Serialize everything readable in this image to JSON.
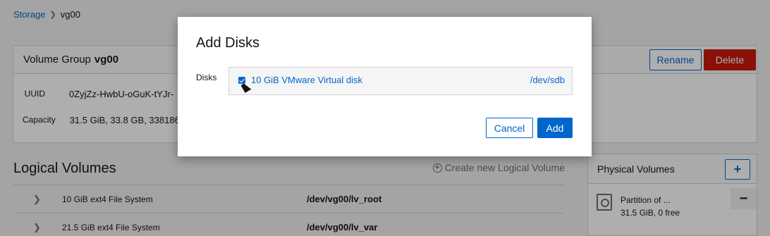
{
  "breadcrumb": {
    "root": "Storage",
    "current": "vg00"
  },
  "volume_group": {
    "label": "Volume Group",
    "name": "vg00",
    "rename_label": "Rename",
    "delete_label": "Delete",
    "uuid_label": "UUID",
    "uuid_value": "0ZyjZz-HwbU-oGuK-tYJr-",
    "capacity_label": "Capacity",
    "capacity_value": "31.5 GiB, 33.8 GB, 3381867"
  },
  "logical_volumes": {
    "title": "Logical Volumes",
    "create_label": "Create new Logical Volume",
    "rows": [
      {
        "description": "10 GiB ext4 File System",
        "path": "/dev/vg00/lv_root"
      },
      {
        "description": "21.5 GiB ext4 File System",
        "path": "/dev/vg00/lv_var"
      }
    ]
  },
  "physical_volumes": {
    "title": "Physical Volumes",
    "add_symbol": "+",
    "item_name": "Partition of ...",
    "item_info": "31.5 GiB, 0 free",
    "remove_symbol": "−"
  },
  "modal": {
    "title": "Add Disks",
    "disks_label": "Disks",
    "disk": {
      "name": "10 GiB VMware Virtual disk",
      "path": "/dev/sdb",
      "checked": true
    },
    "cancel_label": "Cancel",
    "add_label": "Add"
  },
  "colors": {
    "accent": "#0066cc",
    "danger": "#c9190b"
  }
}
